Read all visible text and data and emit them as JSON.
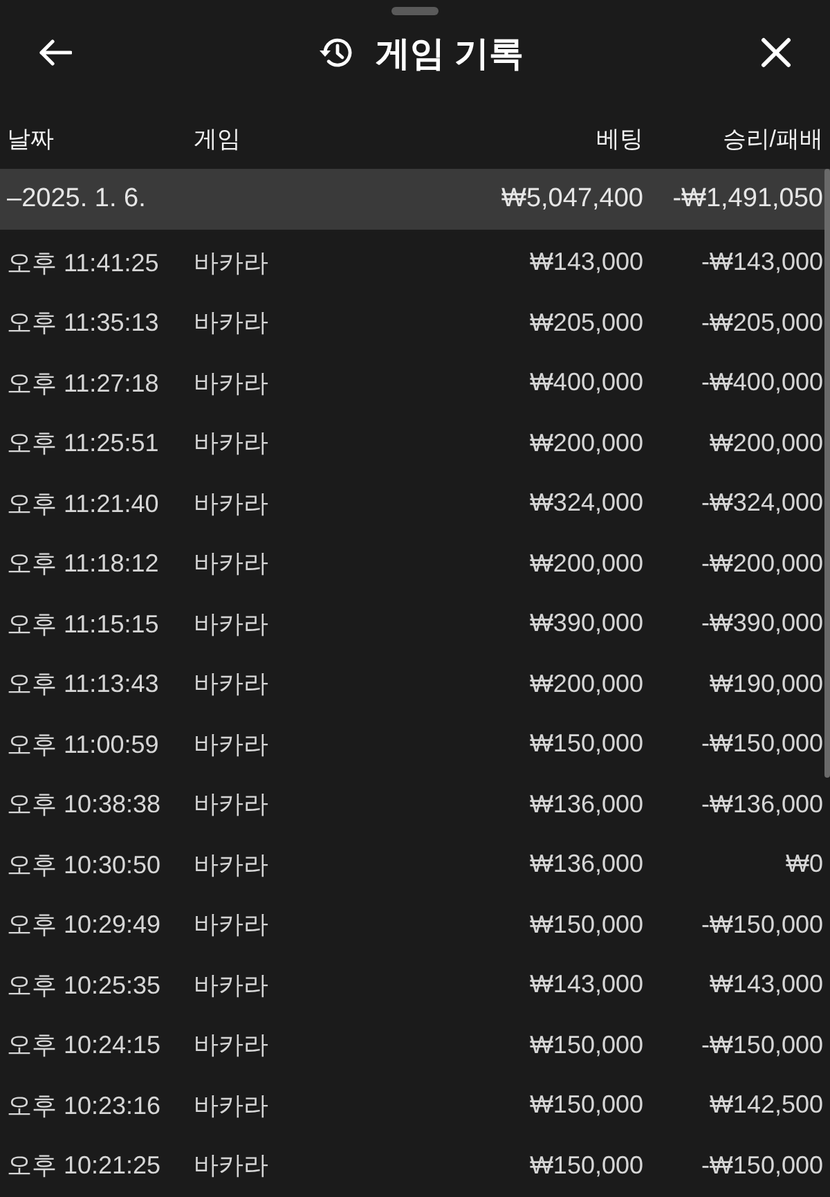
{
  "header": {
    "title": "게임 기록"
  },
  "table": {
    "columns": [
      "날짜",
      "게임",
      "베팅",
      "승리/패배"
    ],
    "groups": [
      {
        "date": "–2025. 1. 6.",
        "bet_total": "₩5,047,400",
        "result_total": "-₩1,491,050",
        "rows": [
          {
            "time": "오후 11:41:25",
            "game": "바카라",
            "bet": "₩143,000",
            "result": "-₩143,000"
          },
          {
            "time": "오후 11:35:13",
            "game": "바카라",
            "bet": "₩205,000",
            "result": "-₩205,000"
          },
          {
            "time": "오후 11:27:18",
            "game": "바카라",
            "bet": "₩400,000",
            "result": "-₩400,000"
          },
          {
            "time": "오후 11:25:51",
            "game": "바카라",
            "bet": "₩200,000",
            "result": "₩200,000"
          },
          {
            "time": "오후 11:21:40",
            "game": "바카라",
            "bet": "₩324,000",
            "result": "-₩324,000"
          },
          {
            "time": "오후 11:18:12",
            "game": "바카라",
            "bet": "₩200,000",
            "result": "-₩200,000"
          },
          {
            "time": "오후 11:15:15",
            "game": "바카라",
            "bet": "₩390,000",
            "result": "-₩390,000"
          },
          {
            "time": "오후 11:13:43",
            "game": "바카라",
            "bet": "₩200,000",
            "result": "₩190,000"
          },
          {
            "time": "오후 11:00:59",
            "game": "바카라",
            "bet": "₩150,000",
            "result": "-₩150,000"
          },
          {
            "time": "오후 10:38:38",
            "game": "바카라",
            "bet": "₩136,000",
            "result": "-₩136,000"
          },
          {
            "time": "오후 10:30:50",
            "game": "바카라",
            "bet": "₩136,000",
            "result": "₩0"
          },
          {
            "time": "오후 10:29:49",
            "game": "바카라",
            "bet": "₩150,000",
            "result": "-₩150,000"
          },
          {
            "time": "오후 10:25:35",
            "game": "바카라",
            "bet": "₩143,000",
            "result": "₩143,000"
          },
          {
            "time": "오후 10:24:15",
            "game": "바카라",
            "bet": "₩150,000",
            "result": "-₩150,000"
          },
          {
            "time": "오후 10:23:16",
            "game": "바카라",
            "bet": "₩150,000",
            "result": "₩142,500"
          },
          {
            "time": "오후 10:21:25",
            "game": "바카라",
            "bet": "₩150,000",
            "result": "-₩150,000"
          }
        ]
      }
    ]
  }
}
